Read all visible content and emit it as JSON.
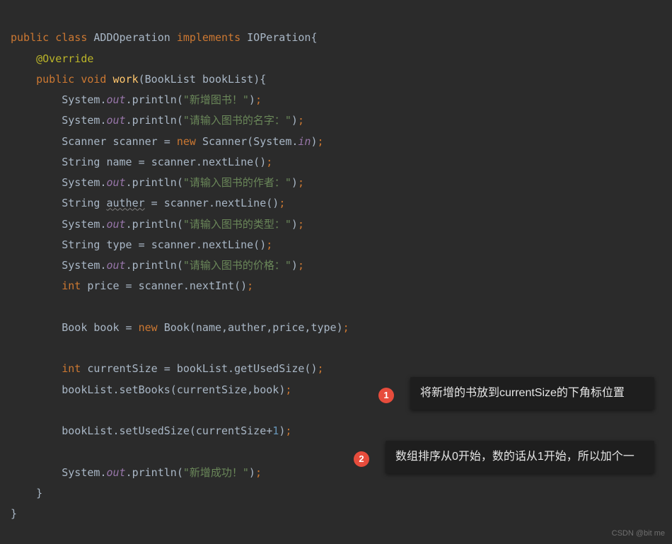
{
  "code": {
    "classDecl": {
      "public": "public",
      "classKw": "class",
      "className": "ADDOperation",
      "implementsKw": "implements",
      "interfaceName": "IOPeration",
      "openBrace": "{"
    },
    "annotation": "@Override",
    "methodDecl": {
      "public": "public",
      "voidKw": "void",
      "methodName": "work",
      "paramType": "BookList",
      "paramName": "bookList",
      "openBrace": "{"
    },
    "lines": {
      "l1_sys": "System",
      "l1_out": "out",
      "l1_method": "println",
      "l1_str": "\"新增图书！\"",
      "l2_str": "\"请输入图书的名字：\"",
      "l3_type": "Scanner",
      "l3_var": "scanner",
      "l3_new": "new",
      "l3_ctor": "Scanner",
      "l3_sysin": "System",
      "l3_in": "in",
      "l4_type": "String",
      "l4_var": "name",
      "l4_call": "scanner.nextLine()",
      "l5_str": "\"请输入图书的作者：\"",
      "l6_type": "String",
      "l6_var": "auther",
      "l6_call": "scanner.nextLine()",
      "l7_str": "\"请输入图书的类型：\"",
      "l8_type": "String",
      "l8_var": "type",
      "l8_call": "scanner.nextLine()",
      "l9_str": "\"请输入图书的价格：\"",
      "l10_type": "int",
      "l10_var": "price",
      "l10_call": "scanner.nextInt()",
      "l11_type": "Book",
      "l11_var": "book",
      "l11_new": "new",
      "l11_ctor": "Book",
      "l11_args": "name,auther,price,type",
      "l12_type": "int",
      "l12_var": "currentSize",
      "l12_call": "bookList.getUsedSize()",
      "l13_obj": "bookList",
      "l13_method": "setBooks",
      "l13_args": "currentSize,book",
      "l14_obj": "bookList",
      "l14_method": "setUsedSize",
      "l14_arg1": "currentSize",
      "l14_plus": "+",
      "l14_num": "1",
      "l15_str": "\"新增成功！\""
    },
    "closeBrace1": "}",
    "closeBrace2": "}"
  },
  "annotations": {
    "badge1": "1",
    "note1": "将新增的书放到currentSize的下角标位置",
    "badge2": "2",
    "note2": "数组排序从0开始，数的话从1开始，所以加个一"
  },
  "watermark": "CSDN @bit me"
}
